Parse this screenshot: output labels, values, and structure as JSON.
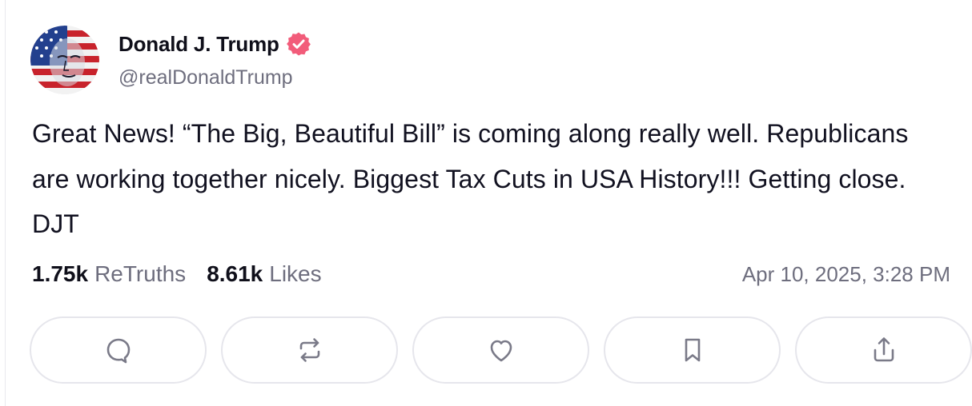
{
  "post": {
    "display_name": "Donald J. Trump",
    "handle": "@realDonaldTrump",
    "verified_icon": "verified-badge-icon",
    "text": "Great News! “The Big, Beautiful Bill” is coming along really well. Republicans are working together nicely. Biggest Tax Cuts in USA History!!! Getting close. DJT",
    "stats": {
      "retruths_count": "1.75k",
      "retruths_label": "ReTruths",
      "likes_count": "8.61k",
      "likes_label": "Likes"
    },
    "timestamp": "Apr 10, 2025, 3:28 PM"
  },
  "actions": [
    {
      "name": "reply",
      "icon": "comment-icon"
    },
    {
      "name": "retruth",
      "icon": "repost-icon"
    },
    {
      "name": "like",
      "icon": "heart-icon"
    },
    {
      "name": "bookmark",
      "icon": "bookmark-icon"
    },
    {
      "name": "share",
      "icon": "share-icon"
    }
  ],
  "colors": {
    "verified_badge": "#f25c7a",
    "text_primary": "#0f0f1a",
    "text_secondary": "#6e6e7e",
    "action_border": "#e6e6ec",
    "icon_stroke": "#7a7a88"
  }
}
